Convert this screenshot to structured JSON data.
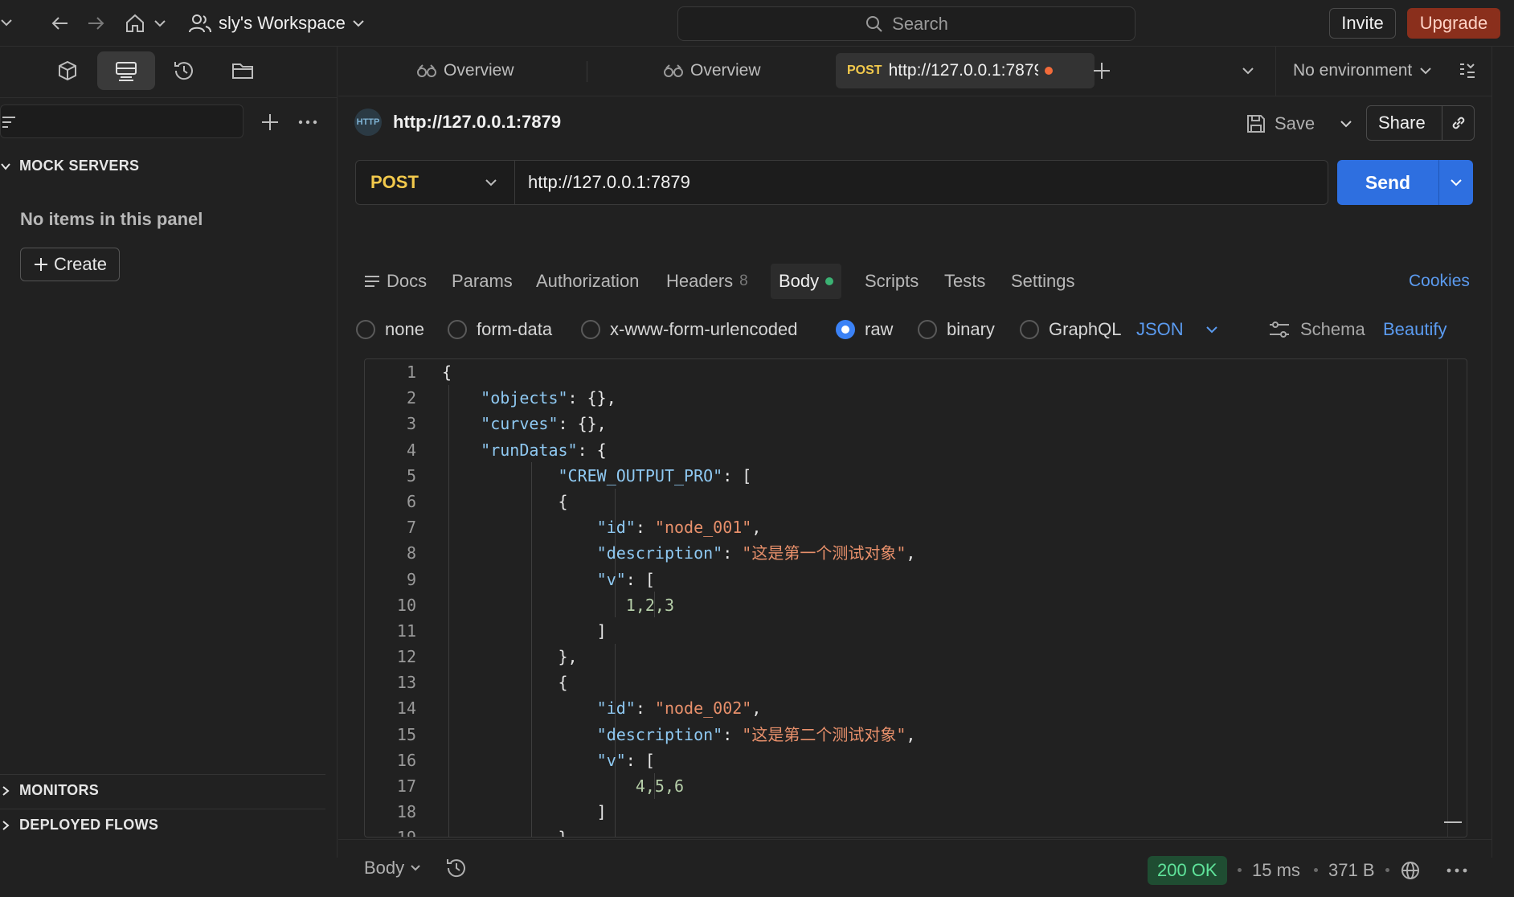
{
  "topbar": {
    "workspace_label": "sly's Workspace",
    "search_placeholder": "Search",
    "invite_label": "Invite",
    "upgrade_label": "Upgrade"
  },
  "sidebar": {
    "section_mock": "MOCK SERVERS",
    "empty_message": "No items in this panel",
    "create_label": "Create",
    "section_monitors": "MONITORS",
    "section_flows": "DEPLOYED FLOWS"
  },
  "tabs": [
    {
      "label": "Overview"
    },
    {
      "label": "Overview"
    },
    {
      "method": "POST",
      "label": "http://127.0.0.1:7879"
    }
  ],
  "environment": "No environment",
  "request": {
    "title": "http://127.0.0.1:7879",
    "save_label": "Save",
    "share_label": "Share",
    "method": "POST",
    "url": "http://127.0.0.1:7879",
    "send_label": "Send"
  },
  "request_tabs": {
    "docs": "Docs",
    "params": "Params",
    "authorization": "Authorization",
    "headers": "Headers",
    "headers_count": "8",
    "body": "Body",
    "scripts": "Scripts",
    "tests": "Tests",
    "settings": "Settings",
    "cookies": "Cookies"
  },
  "body_options": {
    "none": "none",
    "form_data": "form-data",
    "urlencoded": "x-www-form-urlencoded",
    "raw": "raw",
    "binary": "binary",
    "graphql": "GraphQL",
    "format": "JSON",
    "schema": "Schema",
    "beautify": "Beautify",
    "selected": "raw"
  },
  "editor": {
    "line_numbers": [
      "1",
      "2",
      "3",
      "4",
      "5",
      "6",
      "7",
      "8",
      "9",
      "10",
      "11",
      "12",
      "13",
      "14",
      "15",
      "16",
      "17",
      "18",
      "19"
    ]
  },
  "status": {
    "body_label": "Body",
    "code": "200 OK",
    "time": "15 ms",
    "size": "371 B"
  },
  "colors": {
    "accent_blue": "#2e6fe0",
    "method_yellow": "#f2c94c",
    "upgrade_bg": "#8a2f1c",
    "status_green": "#5fe39a"
  }
}
